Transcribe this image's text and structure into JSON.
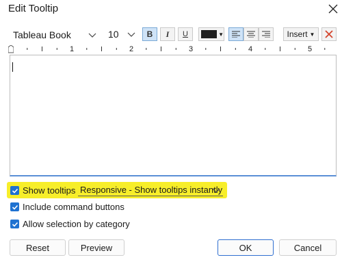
{
  "dialog": {
    "title": "Edit Tooltip"
  },
  "toolbar": {
    "font_family": "Tableau Book",
    "font_size": "10",
    "bold_label": "B",
    "italic_label": "I",
    "underline_label": "U",
    "font_color": "#1f1f1f",
    "insert_label": "Insert"
  },
  "ruler": {
    "labels": [
      "1",
      "2",
      "3",
      "4",
      "5"
    ]
  },
  "options": {
    "show_tooltips_label": "Show tooltips",
    "show_tooltips_checked": true,
    "tooltip_mode": "Responsive - Show tooltips instantly",
    "include_commands_label": "Include command buttons",
    "include_commands_checked": true,
    "allow_selection_label": "Allow selection by category",
    "allow_selection_checked": true
  },
  "buttons": {
    "reset": "Reset",
    "preview": "Preview",
    "ok": "OK",
    "cancel": "Cancel"
  },
  "colors": {
    "accent": "#1f72d1",
    "highlight": "#f7ee2a"
  }
}
